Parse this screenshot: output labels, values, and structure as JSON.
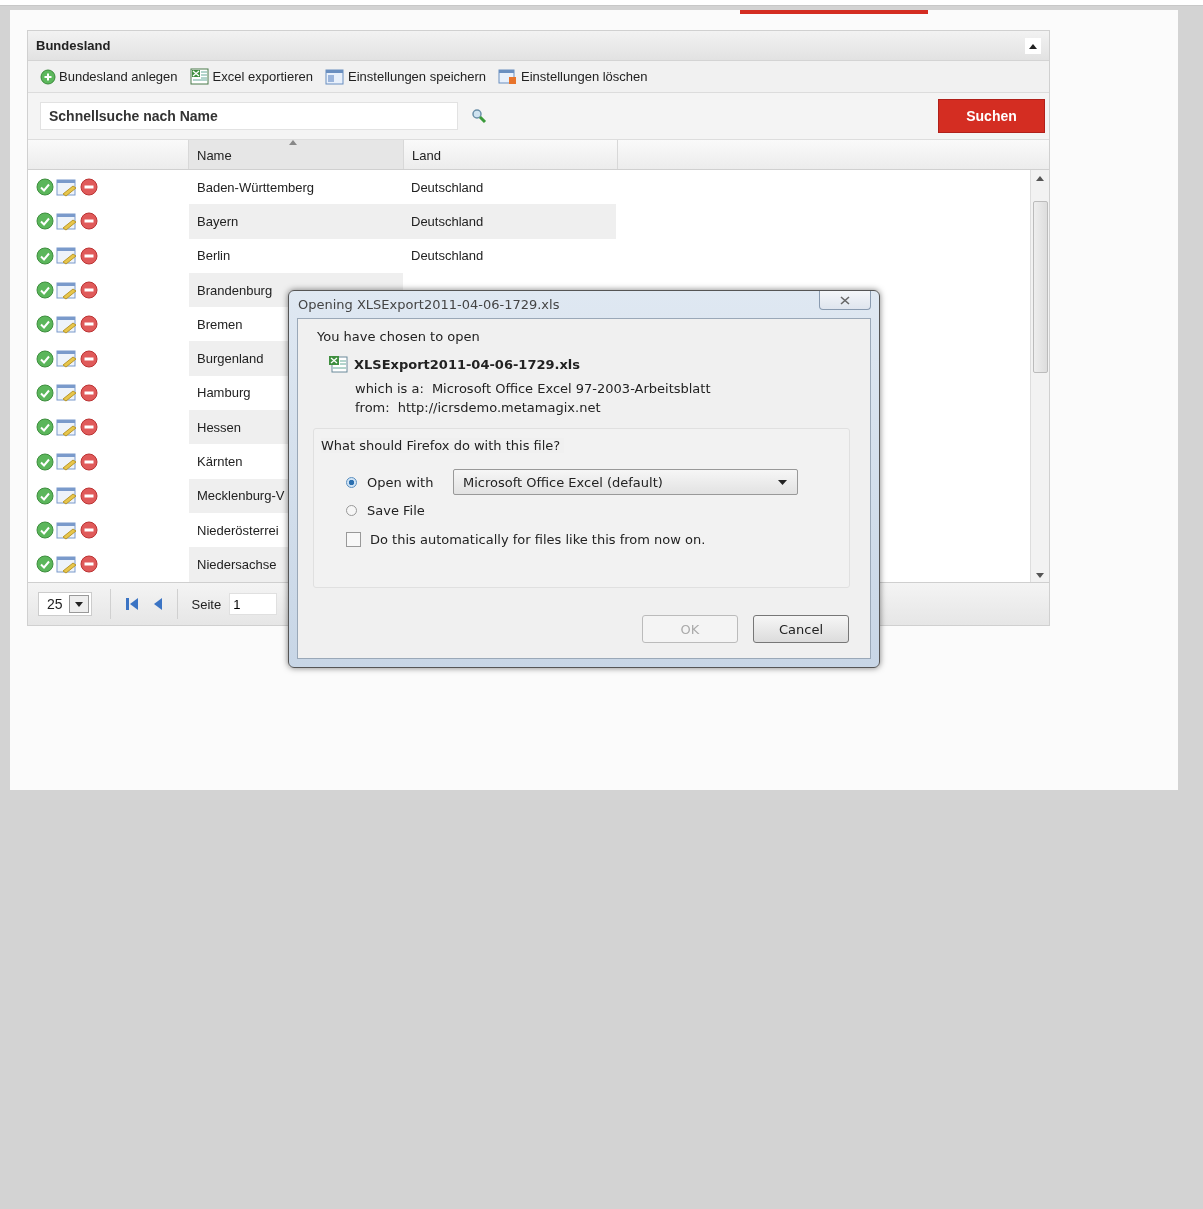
{
  "panel": {
    "title": "Bundesland",
    "toolbar": [
      {
        "label": "Bundesland anlegen",
        "kind": "add"
      },
      {
        "label": "Excel exportieren",
        "kind": "excel"
      },
      {
        "label": "Einstellungen speichern",
        "kind": "save"
      },
      {
        "label": "Einstellungen löschen",
        "kind": "delete"
      }
    ],
    "search": {
      "placeholder": "Schnellsuche nach Name"
    },
    "search_button": "Suchen",
    "columns": [
      "Name",
      "Land"
    ],
    "rows": [
      {
        "name": "Baden-Württemberg",
        "land": "Deutschland"
      },
      {
        "name": "Bayern",
        "land": "Deutschland"
      },
      {
        "name": "Berlin",
        "land": "Deutschland"
      },
      {
        "name": "Brandenburg"
      },
      {
        "name": "Bremen"
      },
      {
        "name": "Burgenland"
      },
      {
        "name": "Hamburg"
      },
      {
        "name": "Hessen"
      },
      {
        "name": "Kärnten"
      },
      {
        "name": "Mecklenburg-V"
      },
      {
        "name": "Niederösterrei"
      },
      {
        "name": "Niedersachse"
      }
    ],
    "pager": {
      "page_size": "25",
      "page_label": "Seite",
      "page": "1"
    }
  },
  "dialog": {
    "title": "Opening XLSExport2011-04-06-1729.xls",
    "intro": "You have chosen to open",
    "filename": "XLSExport2011-04-06-1729.xls",
    "type_label": "which is a:",
    "type": "Microsoft Office Excel 97-2003-Arbeitsblatt",
    "from_label": "from:",
    "from": "http://icrsdemo.metamagix.net",
    "question": "What should Firefox do with this file?",
    "options": [
      {
        "label": "Open with",
        "selected": true
      },
      {
        "label": "Save File",
        "selected": false
      }
    ],
    "app": "Microsoft Office Excel (default)",
    "auto": {
      "label": "Do this automatically for files like this from now on.",
      "checked": false
    },
    "buttons": [
      {
        "label": "OK",
        "disabled": true
      },
      {
        "label": "Cancel",
        "disabled": false
      }
    ]
  }
}
